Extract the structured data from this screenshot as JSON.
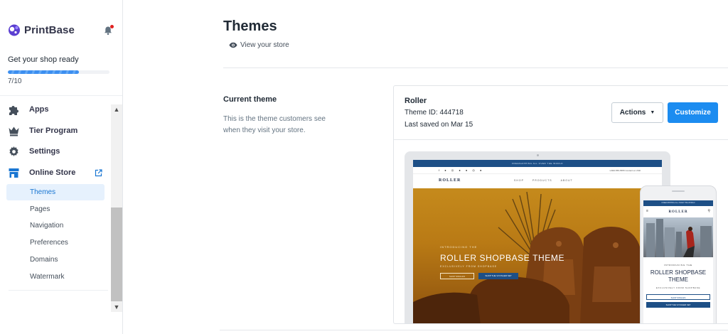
{
  "app": {
    "brand": "PrintBase",
    "brand_color": "#5b3fd1",
    "notification_dot_color": "#e0201f"
  },
  "onboarding": {
    "title": "Get your shop ready",
    "progress_text": "7/10",
    "progress_fraction": 0.7
  },
  "sidebar": {
    "items": [
      {
        "label": "Apps",
        "icon": "puzzle-icon"
      },
      {
        "label": "Tier Program",
        "icon": "crown-icon"
      },
      {
        "label": "Settings",
        "icon": "gear-icon"
      },
      {
        "label": "Online Store",
        "icon": "store-icon"
      }
    ],
    "sub_items": [
      {
        "label": "Themes",
        "active": true
      },
      {
        "label": "Pages"
      },
      {
        "label": "Navigation"
      },
      {
        "label": "Preferences"
      },
      {
        "label": "Domains"
      },
      {
        "label": "Watermark"
      }
    ]
  },
  "main": {
    "title": "Themes",
    "view_store": "View your store",
    "current_theme": {
      "heading": "Current theme",
      "description": "This is the theme customers see when they visit your store.",
      "name": "Roller",
      "theme_id": "Theme ID: 444718",
      "last_saved": "Last saved on Mar 15",
      "actions_label": "Actions",
      "customize_label": "Customize"
    }
  },
  "preview": {
    "announcement": "FREESHIPPING ALL OVER THE WORLD",
    "phone_number": "1-800-555-5555",
    "contact": "Contact us",
    "currency": "USD",
    "logo": "ROLLER",
    "menu": [
      "SHOP",
      "PRODUCTS",
      "ABOUT"
    ],
    "hero_intro": "INTRODUCING THE",
    "hero_title": "ROLLER SHOPBASE THEME",
    "hero_sub": "EXCLUSIVELY FROM SHOPBASE",
    "btn_shop_singles": "SHOP SINGLES",
    "btn_shop_voyager": "SHOP THE VOYAGER SET",
    "phone_title": "ROLLER SHOPBASE THEME",
    "accent_color": "#1d4f86"
  }
}
